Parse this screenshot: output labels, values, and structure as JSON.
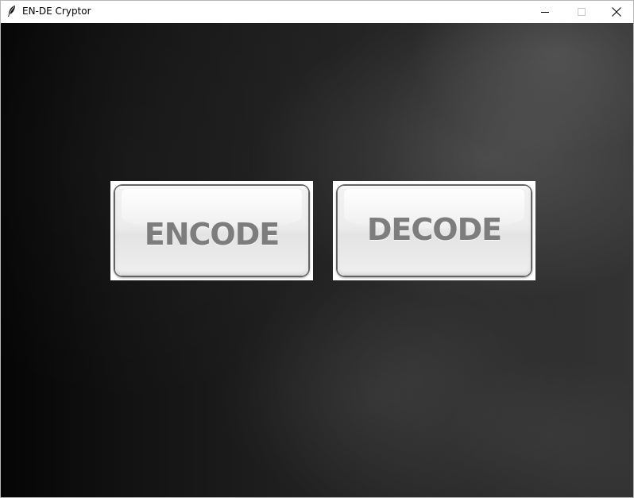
{
  "window": {
    "title": "EN-DE Cryptor",
    "icon": "feather-icon",
    "controls": {
      "minimize": "minimize-icon",
      "maximize": "maximize-icon",
      "close": "close-icon"
    }
  },
  "main": {
    "encode_label": "ENCODE",
    "decode_label": "DECODE"
  },
  "colors": {
    "button_text": "#7d7d7d",
    "background_dark": "#050505",
    "background_light": "#333333"
  }
}
